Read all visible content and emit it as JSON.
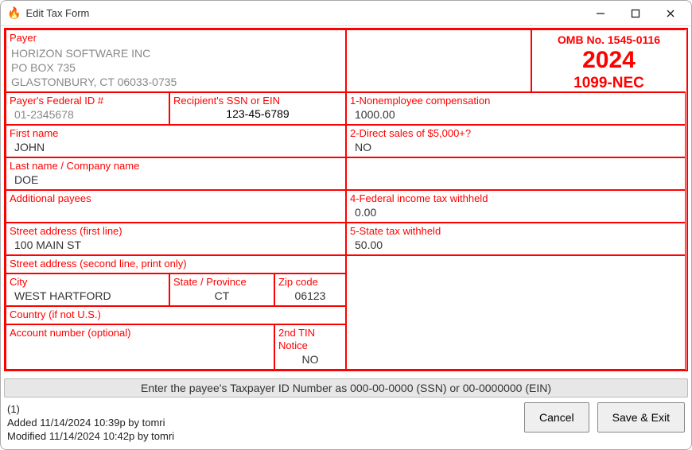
{
  "window": {
    "title": "Edit Tax Form"
  },
  "header": {
    "omb": "OMB No. 1545-0116",
    "year": "2024",
    "form_type": "1099-NEC"
  },
  "payer": {
    "label": "Payer",
    "name": "HORIZON SOFTWARE INC",
    "addr1": "PO BOX 735",
    "addr2": "GLASTONBURY,  CT   06033-0735"
  },
  "fields": {
    "fedid": {
      "label": "Payer's Federal ID #",
      "value": "01-2345678"
    },
    "ssn": {
      "label": "Recipient's SSN or EIN",
      "value": "123-45-6789"
    },
    "first": {
      "label": "First name",
      "value": "JOHN"
    },
    "last": {
      "label": "Last name / Company name",
      "value": "DOE"
    },
    "addl": {
      "label": "Additional payees",
      "value": ""
    },
    "street1": {
      "label": "Street address (first line)",
      "value": "100 MAIN ST"
    },
    "street2": {
      "label": "Street address (second line, print only)",
      "value": ""
    },
    "city": {
      "label": "City",
      "value": "WEST HARTFORD"
    },
    "state": {
      "label": "State / Province",
      "value": "CT"
    },
    "zip": {
      "label": "Zip code",
      "value": "06123"
    },
    "country": {
      "label": "Country (if not U.S.)",
      "value": ""
    },
    "acct": {
      "label": "Account number (optional)",
      "value": ""
    },
    "tin2": {
      "label": "2nd TIN Notice",
      "value": "NO"
    }
  },
  "boxes": {
    "b1": {
      "label": "1-Nonemployee compensation",
      "value": "1000.00"
    },
    "b2": {
      "label": "2-Direct sales of $5,000+?",
      "value": "NO"
    },
    "b4": {
      "label": "4-Federal income tax withheld",
      "value": "0.00"
    },
    "b5": {
      "label": "5-State tax withheld",
      "value": "50.00"
    }
  },
  "hint": "Enter the payee's Taxpayer ID Number as 000-00-0000 (SSN) or 00-0000000 (EIN)",
  "meta": {
    "count": "(1)",
    "added": "Added 11/14/2024 10:39p by tomri",
    "modified": "Modified 11/14/2024 10:42p by tomri"
  },
  "buttons": {
    "cancel": "Cancel",
    "save": "Save & Exit"
  }
}
